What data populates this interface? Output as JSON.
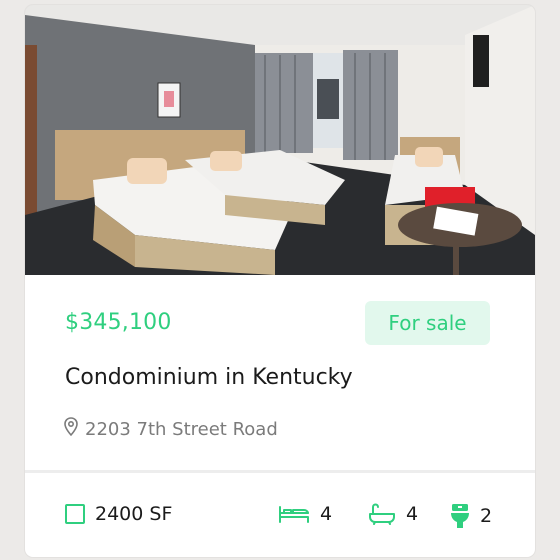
{
  "listing": {
    "price": "$345,100",
    "status": "For sale",
    "title": "Condominium in Kentucky",
    "address": "2203 7th Street Road",
    "area": "2400 SF",
    "beds": "4",
    "baths": "4",
    "toilets": "2"
  },
  "icons": {
    "location": "map-pin-icon",
    "area": "square-icon",
    "beds": "bed-icon",
    "baths": "bathtub-icon",
    "toilets": "toilet-icon"
  },
  "colors": {
    "accent": "#2fcf7f",
    "badge_bg": "#e2f8ed",
    "text": "#1b1b1b",
    "muted": "#7b7b7b"
  }
}
